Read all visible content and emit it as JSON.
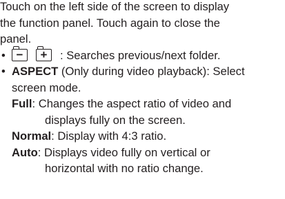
{
  "intro_line1": "Touch on the left side of the screen to display",
  "intro_line2": "the function panel. Touch again to close the",
  "intro_line3": "panel.",
  "bullets": {
    "folder": {
      "prev_icon_symbol": "−",
      "next_icon_symbol": "+",
      "text": ": Searches previous/next folder."
    },
    "aspect": {
      "term": "ASPECT",
      "text_line1": " (Only during video playback): Select",
      "text_line2": "screen mode."
    }
  },
  "modes": {
    "full": {
      "term": "Full",
      "text_line1": ": Changes the aspect ratio of video and",
      "text_line2": "displays fully on the screen."
    },
    "normal": {
      "term": "Normal",
      "text": ": Display with 4:3 ratio."
    },
    "auto": {
      "term": "Auto",
      "text_line1": ": Displays video fully on vertical or",
      "text_line2": "horizontal with no ratio change."
    }
  }
}
